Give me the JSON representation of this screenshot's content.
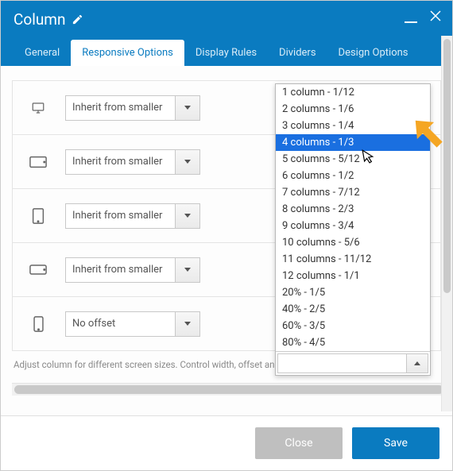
{
  "header": {
    "title": "Column"
  },
  "tabs": [
    {
      "label": "General"
    },
    {
      "label": "Responsive Options"
    },
    {
      "label": "Display Rules"
    },
    {
      "label": "Dividers"
    },
    {
      "label": "Design Options"
    }
  ],
  "active_tab": 1,
  "rows": [
    {
      "device": "desktop",
      "value": "Inherit from smaller"
    },
    {
      "device": "tablet-landscape",
      "value": "Inherit from smaller"
    },
    {
      "device": "tablet-portrait",
      "value": "Inherit from smaller"
    },
    {
      "device": "phone-landscape",
      "value": "Inherit from smaller"
    },
    {
      "device": "phone-portrait",
      "value": "No offset"
    }
  ],
  "dropdown": {
    "options": [
      "1 column - 1/12",
      "2 columns - 1/6",
      "3 columns - 1/4",
      "4 columns - 1/3",
      "5 columns - 5/12",
      "6 columns - 1/2",
      "7 columns - 7/12",
      "8 columns - 2/3",
      "9 columns - 3/4",
      "10 columns - 5/6",
      "11 columns - 11/12",
      "12 columns - 1/1",
      "20% - 1/5",
      "40% - 2/5",
      "60% - 3/5",
      "80% - 4/5"
    ],
    "selected_index": 3
  },
  "helper_text": "Adjust column for different screen sizes. Control width, offset and visibility settings.",
  "footer": {
    "close": "Close",
    "save": "Save"
  }
}
